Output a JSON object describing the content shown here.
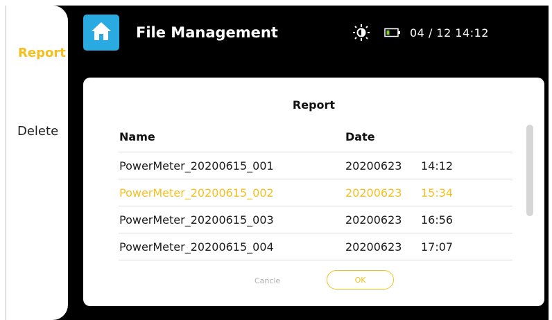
{
  "header": {
    "title": "File Management",
    "home_icon": "home-icon",
    "brightness_icon": "brightness-icon",
    "battery_icon": "battery-icon",
    "datetime": "04 / 12  14:12"
  },
  "sidebar": {
    "items": [
      {
        "label": "Report",
        "active": true
      },
      {
        "label": "Delete",
        "active": false
      }
    ]
  },
  "dialog": {
    "title": "Report",
    "columns": {
      "name": "Name",
      "date": "Date"
    },
    "rows": [
      {
        "name": "PowerMeter_20200615_001",
        "date": "20200623",
        "time": "14:12",
        "selected": false
      },
      {
        "name": "PowerMeter_20200615_002",
        "date": "20200623",
        "time": "15:34",
        "selected": true
      },
      {
        "name": "PowerMeter_20200615_003",
        "date": "20200623",
        "time": "16:56",
        "selected": false
      },
      {
        "name": "PowerMeter_20200615_004",
        "date": "20200623",
        "time": "17:07",
        "selected": false
      }
    ],
    "cancel_label": "Cancle",
    "ok_label": "OK"
  },
  "colors": {
    "accent": "#f4c021",
    "home_button": "#29abe2",
    "background": "#000000"
  }
}
